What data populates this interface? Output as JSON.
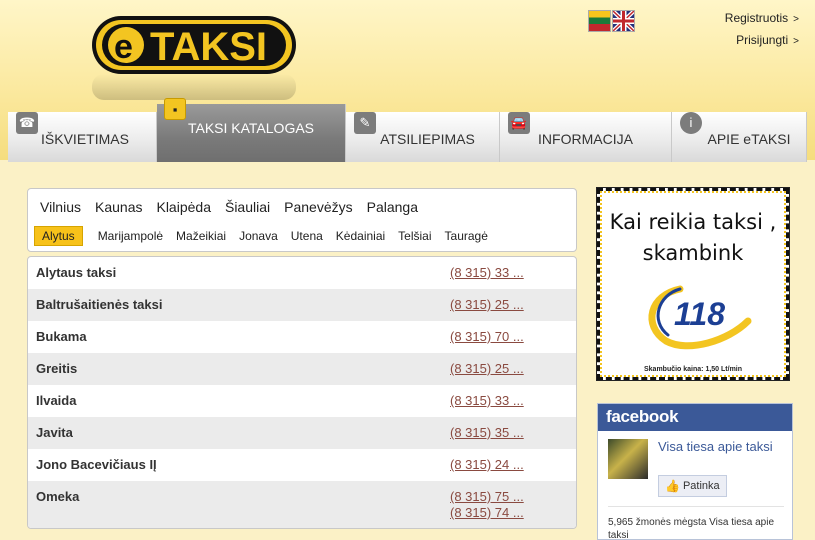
{
  "header": {
    "logo_text": "eTAKSI",
    "flags": [
      {
        "name": "lithuanian-flag-icon"
      },
      {
        "name": "english-flag-icon"
      }
    ],
    "links": [
      {
        "label": "Registruotis",
        "chevron": ">"
      },
      {
        "label": "Prisijungti",
        "chevron": ">"
      }
    ]
  },
  "nav": {
    "tabs": [
      {
        "label": "IŠKVIETIMAS",
        "icon": "phone-person-icon",
        "active": false
      },
      {
        "label": "TAKSI KATALOGAS",
        "icon": "taxi-sign-icon",
        "active": true
      },
      {
        "label": "ATSILIEPIMAS",
        "icon": "notepad-icon",
        "active": false
      },
      {
        "label": "INFORMACIJA",
        "icon": "car-icon",
        "active": false
      },
      {
        "label": "APIE eTAKSI",
        "icon": "info-icon",
        "active": false
      }
    ]
  },
  "cities": {
    "main": [
      "Vilnius",
      "Kaunas",
      "Klaipėda",
      "Šiauliai",
      "Panevėžys",
      "Palanga"
    ],
    "secondary": [
      "Alytus",
      "Marijampolė",
      "Mažeikiai",
      "Jonava",
      "Utena",
      "Kėdainiai",
      "Telšiai",
      "Tauragė"
    ],
    "selected": "Alytus"
  },
  "companies": [
    {
      "name": "Alytaus taksi",
      "phones": [
        "(8 315) 33 ..."
      ]
    },
    {
      "name": "Baltrušaitienės taksi",
      "phones": [
        "(8 315) 25 ..."
      ]
    },
    {
      "name": "Bukama",
      "phones": [
        "(8 315) 70 ..."
      ]
    },
    {
      "name": "Greitis",
      "phones": [
        "(8 315) 25 ..."
      ]
    },
    {
      "name": "Ilvaida",
      "phones": [
        "(8 315) 33 ..."
      ]
    },
    {
      "name": "Javita",
      "phones": [
        "(8 315) 35 ..."
      ]
    },
    {
      "name": "Jono Bacevičiaus IĮ",
      "phones": [
        "(8 315) 24 ..."
      ]
    },
    {
      "name": "Omeka",
      "phones": [
        "(8 315) 75 ...",
        "(8 315) 74 ..."
      ]
    }
  ],
  "ad": {
    "line1": "Kai reikia taksi ,",
    "line2": "skambink",
    "number": "118",
    "price": "Skambučio kaina: 1,50 Lt/min"
  },
  "facebook": {
    "brand": "facebook",
    "page_name": "Visa tiesa apie taksi",
    "like_label": "Patinka",
    "count_text": "5,965 žmonės mėgsta Visa tiesa apie taksi"
  },
  "colors": {
    "accent": "#f3c521",
    "phone_link": "#8a4a40",
    "facebook": "#3b5998"
  }
}
